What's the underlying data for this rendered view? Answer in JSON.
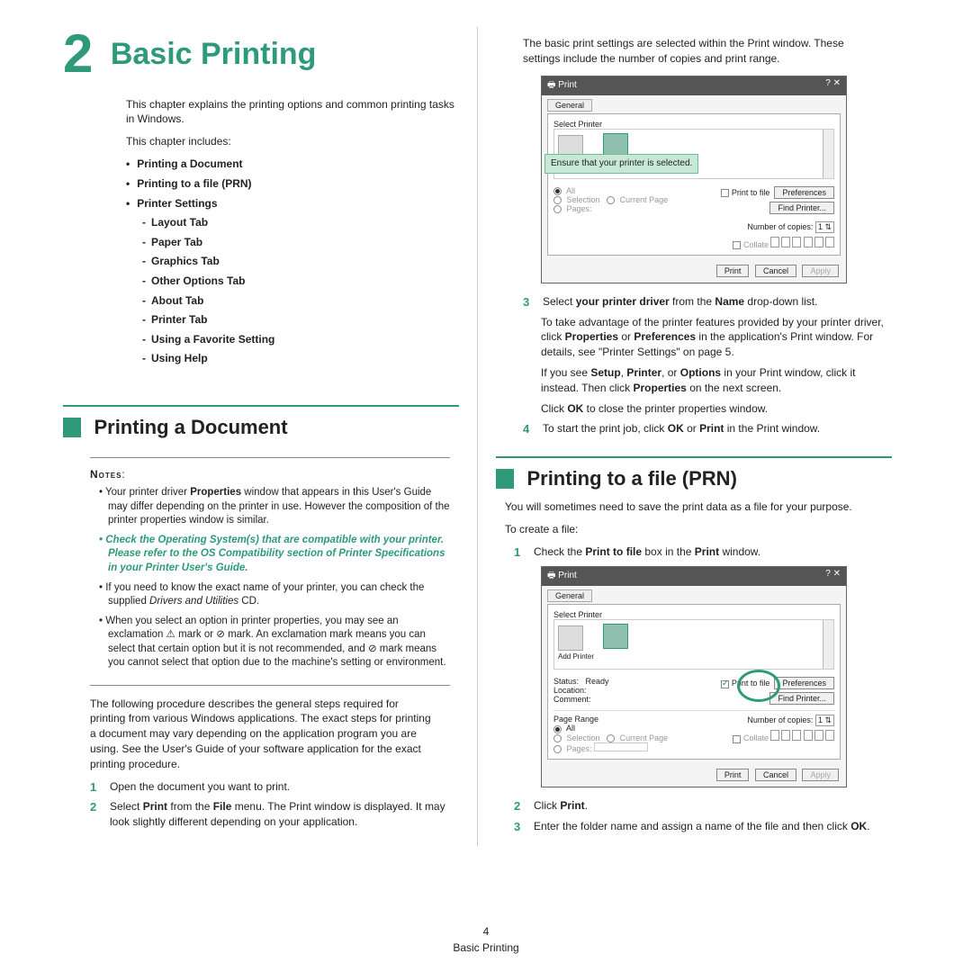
{
  "chapter": {
    "number": "2",
    "title": "Basic Printing"
  },
  "intro": "This chapter explains the printing options and common printing tasks in Windows.",
  "includes_label": "This chapter includes:",
  "toc": {
    "i1": "Printing a Document",
    "i2": "Printing to a file (PRN)",
    "i3": "Printer Settings",
    "s1": "Layout Tab",
    "s2": "Paper Tab",
    "s3": "Graphics Tab",
    "s4": "Other Options Tab",
    "s5": "About Tab",
    "s6": "Printer Tab",
    "s7": "Using a Favorite Setting",
    "s8": "Using Help"
  },
  "sec1": {
    "title": "Printing a Document"
  },
  "notes": {
    "label": "Notes",
    "n1a": "Your printer driver ",
    "n1b": "Properties",
    "n1c": " window that appears in this User's Guide may differ depending on the printer in use. However the composition of the printer properties window is similar.",
    "n2": "Check the Operating System(s) that are compatible with your printer. Please refer to the OS Compatibility section of Printer Specifications in your Printer User's Guide.",
    "n3a": "If you need to know the exact name of your printer, you can check the supplied ",
    "n3b": "Drivers and Utilities",
    "n3c": " CD.",
    "n4": "When you select an option in printer properties, you may see an exclamation ⚠ mark or ⊘ mark. An exclamation mark means you can select that certain option but it is not recommended, and ⊘ mark means you cannot select that option due to the machine's setting or environment."
  },
  "proc_intro": "The following procedure describes the general steps required for printing from various Windows applications. The exact steps for printing a document may vary depending on the application program you are using. See the User's Guide of your software application for the exact printing procedure.",
  "steps_a": {
    "s1": "Open the document you want to print.",
    "s2a": "Select ",
    "s2b": "Print",
    "s2c": " from the ",
    "s2d": "File",
    "s2e": " menu. The Print window is displayed. It may look slightly different depending on your application."
  },
  "col2_top": "The basic print settings are selected within the Print window. These settings include the number of copies and print range.",
  "fig1": {
    "title": "Print",
    "tab": "General",
    "group": "Select Printer",
    "addprinter": "Add Printer",
    "callout": "Ensure that your printer is selected.",
    "ptf": "Print to file",
    "pref": "Preferences",
    "find": "Find Printer...",
    "copies": "Number of copies:",
    "copies_val": "1",
    "collate": "Collate",
    "all": "All",
    "sel": "Selection",
    "cur": "Current Page",
    "pages": "Pages:",
    "print": "Print",
    "cancel": "Cancel",
    "apply": "Apply"
  },
  "steps_b": {
    "s3a": "Select ",
    "s3b": "your printer driver",
    "s3c": " from the ",
    "s3d": "Name",
    "s3e": " drop-down list.",
    "p1a": "To take advantage of the printer features provided by your printer driver, click ",
    "p1b": "Properties",
    "p1c": " or ",
    "p1d": "Preferences",
    "p1e": " in the application's Print window. For details, see \"Printer Settings\" on page 5.",
    "p2a": "If you see ",
    "p2b": "Setup",
    "p2c": ", ",
    "p2d": "Printer",
    "p2e": ", or ",
    "p2f": "Options",
    "p2g": " in your Print window, click it instead. Then click ",
    "p2h": "Properties",
    "p2i": " on the next screen.",
    "p3a": "Click ",
    "p3b": "OK",
    "p3c": " to close the printer properties window.",
    "s4a": "To start the print job, click ",
    "s4b": "OK",
    "s4c": " or ",
    "s4d": "Print",
    "s4e": " in the Print window."
  },
  "sec2": {
    "title": "Printing to a file (PRN)"
  },
  "prn_intro": "You will sometimes need to save the print data as a file for your purpose.",
  "prn_create": "To create a file:",
  "prn_steps": {
    "s1a": "Check the ",
    "s1b": "Print to file",
    "s1c": " box in the ",
    "s1d": "Print",
    "s1e": " window.",
    "s2a": "Click ",
    "s2b": "Print",
    "s2c": ".",
    "s3a": "Enter the folder name and assign a name of the file and then click ",
    "s3b": "OK",
    "s3c": "."
  },
  "fig2": {
    "status_l": "Status:",
    "status_v": "Ready",
    "loc": "Location:",
    "com": "Comment:",
    "range": "Page Range"
  },
  "footer": {
    "page": "4",
    "title": "Basic Printing"
  }
}
